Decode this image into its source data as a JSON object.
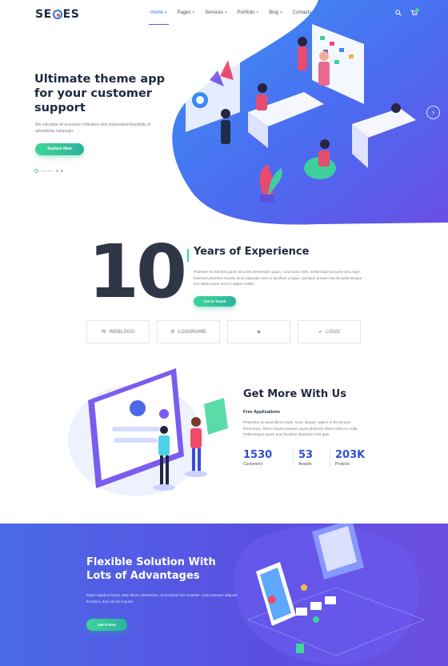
{
  "brand": {
    "logo_text_left": "SE",
    "logo_text_right": "ES"
  },
  "nav": {
    "items": [
      {
        "label": "Home",
        "active": true,
        "dropdown": true
      },
      {
        "label": "Pages",
        "dropdown": true
      },
      {
        "label": "Services",
        "dropdown": true
      },
      {
        "label": "Portfolio",
        "dropdown": true
      },
      {
        "label": "Blog",
        "dropdown": true
      },
      {
        "label": "Contacts",
        "dropdown": false
      }
    ],
    "icons": [
      "search-icon",
      "cart-icon"
    ]
  },
  "hero": {
    "title": "Ultimate theme app for your customer support",
    "subtitle": "We calculate all economic indicators and understand feasibility of advertising campaign",
    "button": "Explore Now",
    "slider_count": 3,
    "slider_active": 1
  },
  "experience": {
    "number": "10",
    "title": "Years of Experience",
    "text": "Praesent eu lobortis purus, sit amet elementum quam. Cras tortor nibh, scelerisque posuere arcu eget, interdum pharetra mauris. Duis vulputate ante in faucibus congue. Quisque pretium iaculis pellentesque sed ullamcorper eros in sapien mollis.",
    "button": "Get in Touch",
    "partner_logos": [
      {
        "name": "WEBLOGO",
        "tagline": ""
      },
      {
        "name": "LOGONAME",
        "tagline": ""
      },
      {
        "name": "",
        "tagline": ""
      },
      {
        "name": "LOGO",
        "tagline": ""
      }
    ]
  },
  "get_more": {
    "title": "Get More With Us",
    "subtitle": "Free Applications",
    "text": "Phasellus sit amet libero turpis. Nunc aliquet, sapien in fermentum fermentum, libero mauris posuere quam pharetra, libero dolor eu nulla. Pellentesque quam quis faucibus dignissim felis quis.",
    "stats": [
      {
        "value": "1530",
        "label": "Customers"
      },
      {
        "value": "53",
        "label": "Awards"
      },
      {
        "value": "203K",
        "label": "Projects"
      }
    ]
  },
  "flexible": {
    "title": "Flexible Solution With Lots of Advantages",
    "text": "Etiam dapibus lectus vitae libero elementum, ut hendrerit leo molestie. Cras posuere aliquam tincidunt, duis vel dui mauris.",
    "button": "Get It Now"
  },
  "colors": {
    "accent_blue": "#3a6cf2",
    "accent_green": "#3ed598",
    "heading": "#1f2940",
    "hero_gradient_start": "#3a8bf5",
    "hero_gradient_end": "#6a4ee6"
  }
}
